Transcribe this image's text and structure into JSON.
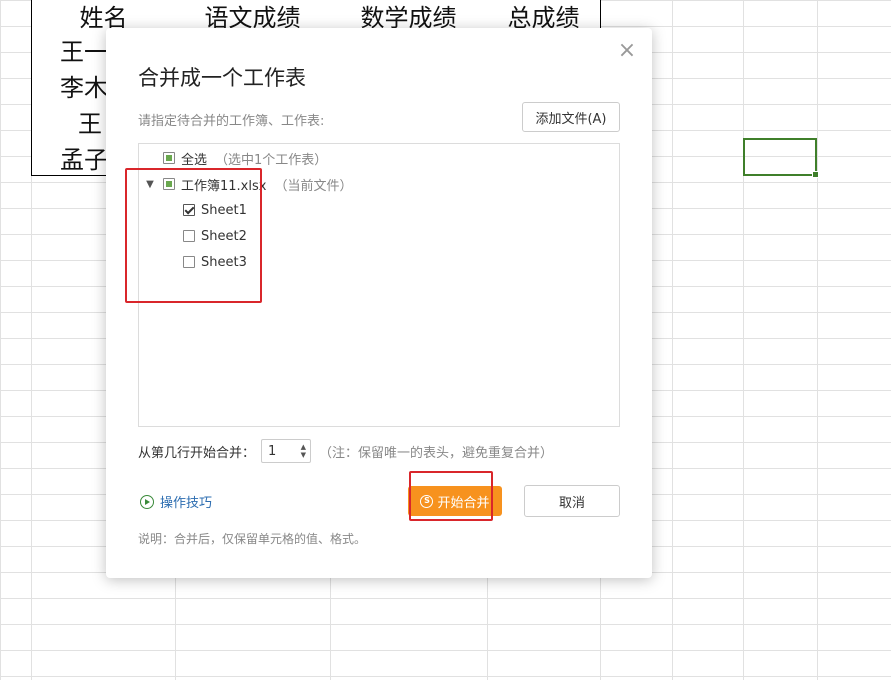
{
  "sheet": {
    "headers": [
      "姓名",
      "语文成绩",
      "数学成绩",
      "总成绩"
    ],
    "names": [
      "王一",
      "李木",
      "王",
      "孟子"
    ]
  },
  "dialog": {
    "title": "合并成一个工作表",
    "close_icon": "close-icon",
    "subtitle": "请指定待合并的工作簿、工作表:",
    "add_file_label": "添加文件(A)",
    "tree": {
      "select_all_label": "全选",
      "select_all_note": "（选中1个工作表）",
      "workbook_label": "工作簿11.xlsx",
      "workbook_note": "（当前文件）",
      "sheets": [
        {
          "label": "Sheet1",
          "checked": true
        },
        {
          "label": "Sheet2",
          "checked": false
        },
        {
          "label": "Sheet3",
          "checked": false
        }
      ]
    },
    "start_row_label": "从第几行开始合并：",
    "start_row_value": "1",
    "start_row_note": "（注：保留唯一的表头，避免重复合并）",
    "tips_label": "操作技巧",
    "merge_label": "开始合并",
    "cancel_label": "取消",
    "footnote": "说明：合并后，仅保留单元格的值、格式。"
  },
  "colors": {
    "accent_orange": "#f7921e",
    "highlight_red": "#d9262b",
    "selection_green": "#3f7f2a",
    "link_blue": "#2b6cb0"
  }
}
